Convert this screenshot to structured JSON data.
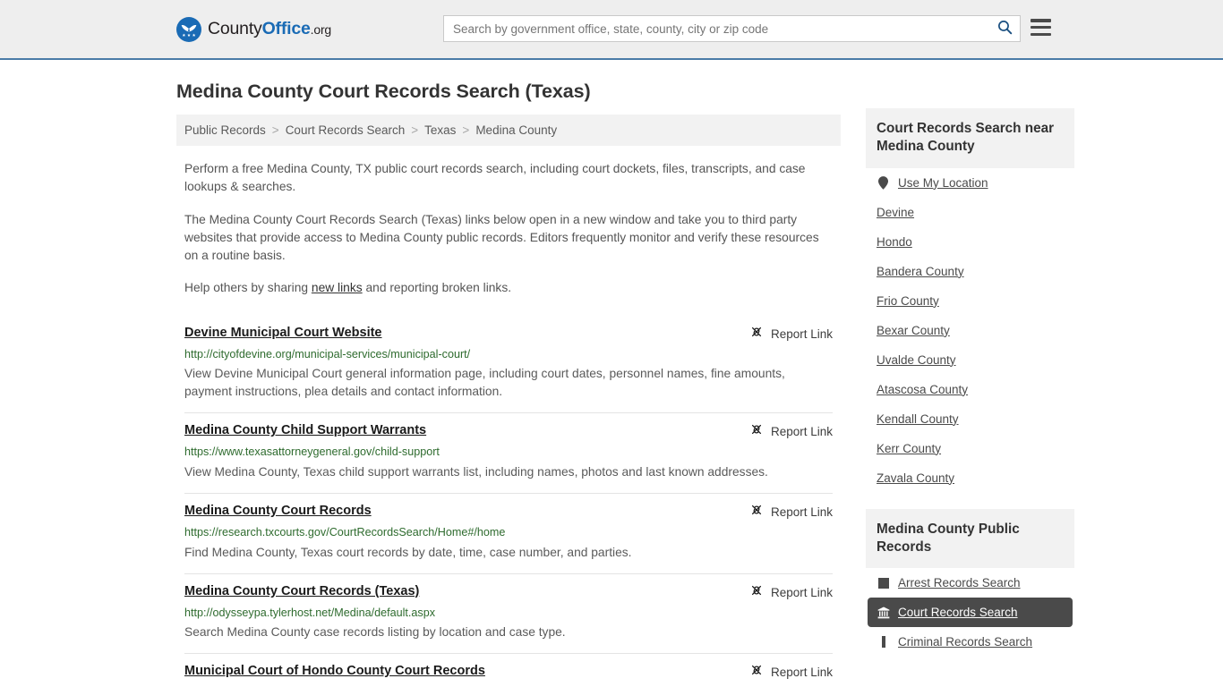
{
  "header": {
    "logo": {
      "icon": "countyoffice-eagle-logo-icon",
      "text_county": "County",
      "text_office": "Office",
      "text_tld": ".org"
    },
    "search": {
      "placeholder": "Search by government office, state, county, city or zip code",
      "value": "",
      "search_icon": "search-icon"
    },
    "menu_icon": "hamburger-menu-icon",
    "accent_color": "#4a7ba7",
    "background_color": "#eeeeee"
  },
  "main": {
    "page_title": "Medina County Court Records Search (Texas)",
    "breadcrumb": [
      {
        "label": "Public Records",
        "current": false
      },
      {
        "label": "Court Records Search",
        "current": false
      },
      {
        "label": "Texas",
        "current": false
      },
      {
        "label": "Medina County",
        "current": true
      }
    ],
    "breadcrumb_separator": ">",
    "paragraphs": [
      "Perform a free Medina County, TX public court records search, including court dockets, files, transcripts, and case lookups & searches.",
      "The Medina County Court Records Search (Texas) links below open in a new window and take you to third party websites that provide access to Medina County public records. Editors frequently monitor and verify these resources on a routine basis."
    ],
    "help_line": {
      "before": "Help others by sharing ",
      "link": "new links",
      "after": " and reporting broken links."
    },
    "report_link_label": "Report Link",
    "report_link_icon": "broken-link-icon",
    "results": [
      {
        "title": "Devine Municipal Court Website",
        "url": "http://cityofdevine.org/municipal-services/municipal-court/",
        "description": "View Devine Municipal Court general information page, including court dates, personnel names, fine amounts, payment instructions, plea details and contact information."
      },
      {
        "title": "Medina County Child Support Warrants",
        "url": "https://www.texasattorneygeneral.gov/child-support",
        "description": "View Medina County, Texas child support warrants list, including names, photos and last known addresses."
      },
      {
        "title": "Medina County Court Records",
        "url": "https://research.txcourts.gov/CourtRecordsSearch/Home#/home",
        "description": "Find Medina County, Texas court records by date, time, case number, and parties."
      },
      {
        "title": "Medina County Court Records (Texas)",
        "url": "http://odysseypa.tylerhost.net/Medina/default.aspx",
        "description": "Search Medina County case records listing by location and case type."
      },
      {
        "title": "Municipal Court of Hondo County Court Records",
        "url": "",
        "description": ""
      }
    ]
  },
  "sidebar": {
    "nearby_panel": {
      "title": "Court Records Search near Medina County",
      "items": [
        {
          "label": "Use My Location",
          "icon": "location-pin-icon"
        },
        {
          "label": "Devine",
          "icon": ""
        },
        {
          "label": "Hondo",
          "icon": ""
        },
        {
          "label": "Bandera County",
          "icon": ""
        },
        {
          "label": "Frio County",
          "icon": ""
        },
        {
          "label": "Bexar County",
          "icon": ""
        },
        {
          "label": "Uvalde County",
          "icon": ""
        },
        {
          "label": "Atascosa County",
          "icon": ""
        },
        {
          "label": "Kendall County",
          "icon": ""
        },
        {
          "label": "Kerr County",
          "icon": ""
        },
        {
          "label": "Zavala County",
          "icon": ""
        }
      ]
    },
    "public_records_panel": {
      "title": "Medina County Public Records",
      "active_color": "#4a4a4a",
      "items": [
        {
          "label": "Arrest Records Search",
          "icon": "handcuffs-icon",
          "active": false
        },
        {
          "label": "Court Records Search",
          "icon": "courthouse-icon",
          "active": true
        },
        {
          "label": "Criminal Records Search",
          "icon": "fingerprint-icon",
          "active": false
        }
      ]
    }
  }
}
